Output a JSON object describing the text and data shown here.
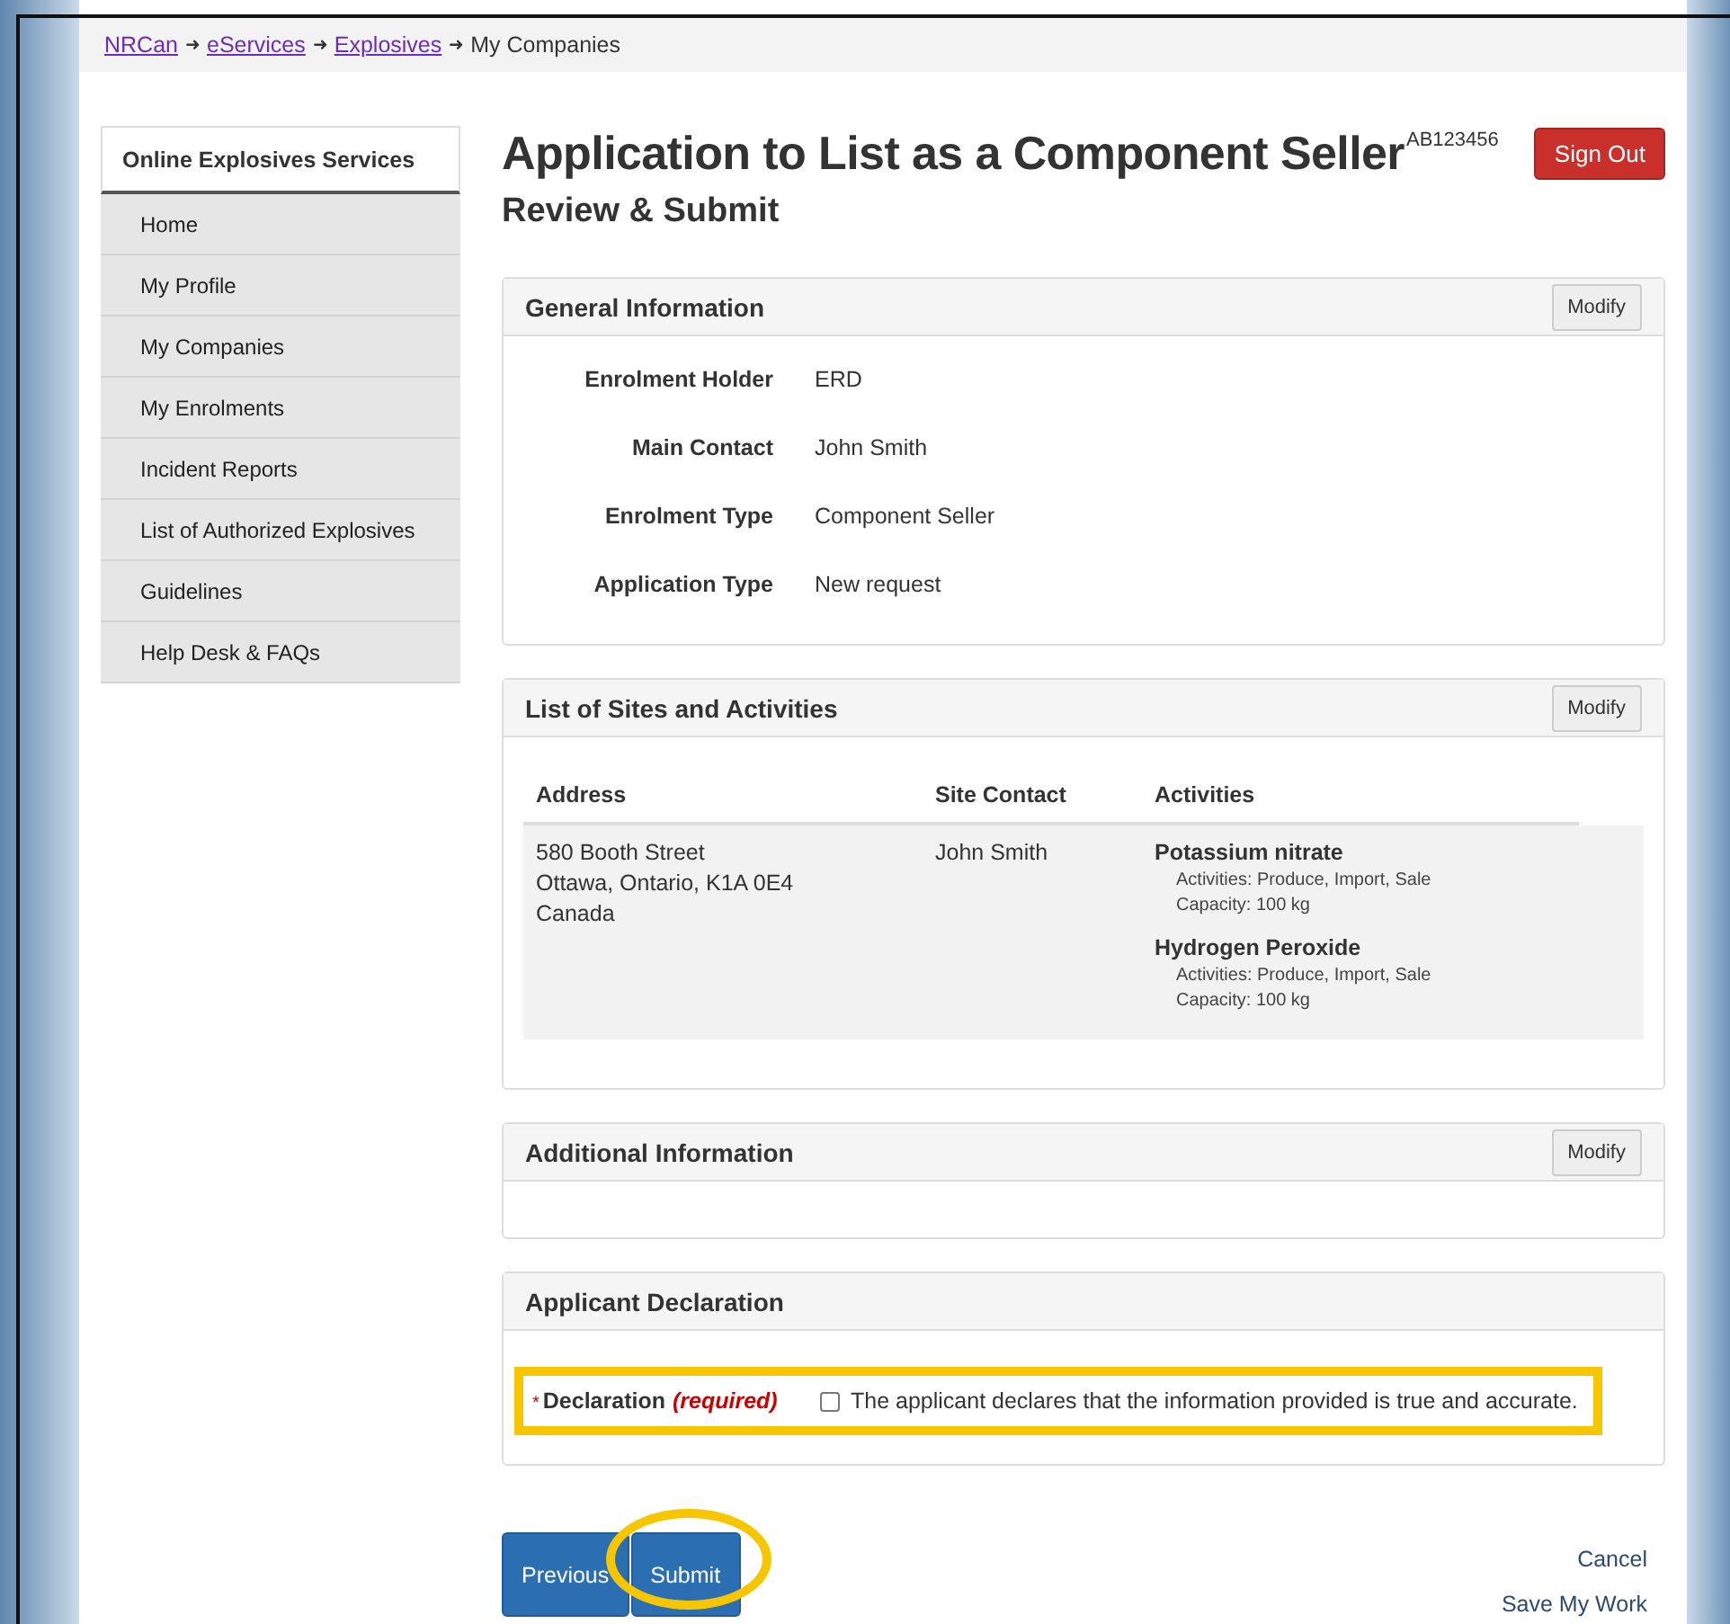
{
  "breadcrumb": [
    {
      "kind": "link",
      "text": "NRCan"
    },
    {
      "kind": "separator",
      "text": "➜"
    },
    {
      "kind": "link",
      "text": "eServices"
    },
    {
      "kind": "separator",
      "text": "➜"
    },
    {
      "kind": "link",
      "text": "Explosives"
    },
    {
      "kind": "separator",
      "text": "➜"
    },
    {
      "kind": "current",
      "text": "My Companies"
    }
  ],
  "sidebar": {
    "title": "Online Explosives Services",
    "items": [
      "Home",
      "My Profile",
      "My Companies",
      "My Enrolments",
      "Incident Reports",
      "List of Authorized Explosives",
      "Guidelines",
      "Help Desk & FAQs"
    ]
  },
  "header": {
    "title": "Application to List as a Component Seller",
    "reference": "AB123456",
    "subtitle": "Review & Submit",
    "sign_out": "Sign Out"
  },
  "general": {
    "title": "General Information",
    "modify": "Modify",
    "fields": [
      {
        "label": "Enrolment Holder",
        "value": "ERD"
      },
      {
        "label": "Main Contact",
        "value": "John Smith"
      },
      {
        "label": "Enrolment Type",
        "value": "Component Seller"
      },
      {
        "label": "Application Type",
        "value": "New request"
      }
    ]
  },
  "sites": {
    "title": "List of Sites and Activities",
    "modify": "Modify",
    "columns": [
      "Address",
      "Site Contact",
      "Activities"
    ],
    "rows": [
      {
        "address": [
          "580 Booth Street",
          "Ottawa, Ontario, K1A 0E4",
          "Canada"
        ],
        "contact": "John Smith",
        "substances": [
          {
            "name": "Potassium nitrate",
            "activities": "Activities: Produce, Import, Sale",
            "capacity": "Capacity: 100 kg"
          },
          {
            "name": "Hydrogen Peroxide",
            "activities": "Activities: Produce, Import, Sale",
            "capacity": "Capacity: 100 kg"
          }
        ]
      }
    ]
  },
  "additional": {
    "title": "Additional Information",
    "modify": "Modify"
  },
  "declaration": {
    "title": "Applicant Declaration",
    "asterisk": "*",
    "label": "Declaration",
    "required": "(required)",
    "checked": false,
    "highlighted": true,
    "text": "The applicant declares that the information provided is true and accurate."
  },
  "actions": {
    "previous": "Previous",
    "submit": "Submit",
    "cancel": "Cancel",
    "save": "Save My Work",
    "submit_highlighted": true
  }
}
